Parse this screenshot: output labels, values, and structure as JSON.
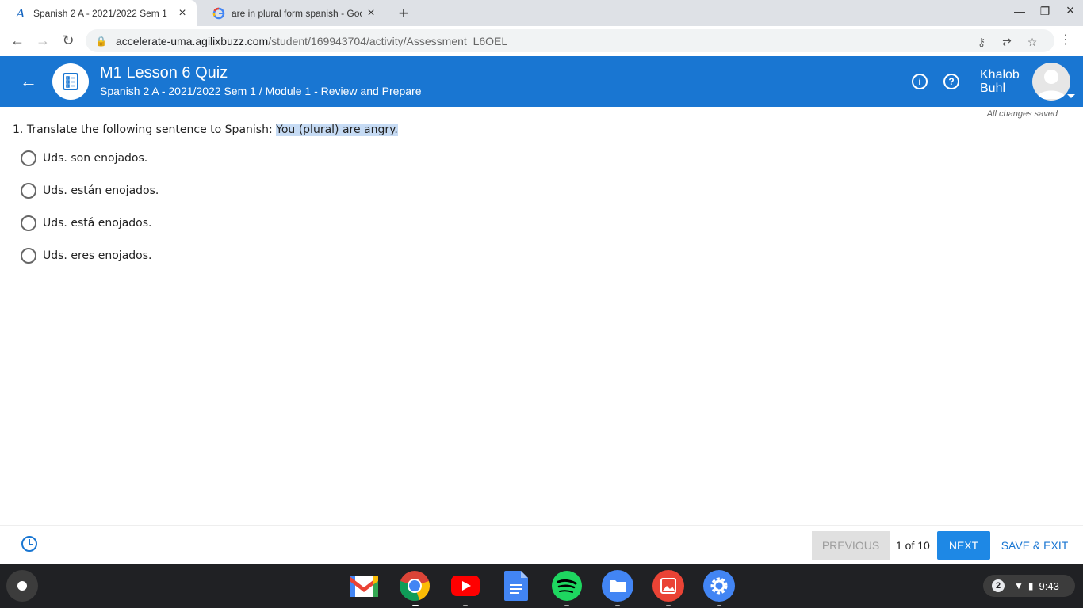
{
  "browser": {
    "tabs": [
      {
        "title": "Spanish 2 A - 2021/2022 Sem 1",
        "favicon": "agilix-logo-icon"
      },
      {
        "title": "are in plural form spanish - Goog",
        "favicon": "google-icon"
      }
    ],
    "url_domain": "accelerate-uma.agilixbuzz.com",
    "url_path": "/student/169943704/activity/Assessment_L6OEL"
  },
  "header": {
    "title": "M1 Lesson 6 Quiz",
    "subtitle": "Spanish 2 A - 2021/2022 Sem 1 / Module 1 - Review and Prepare",
    "user_first": "Khalob",
    "user_last": "Buhl",
    "accent_color": "#1976d2"
  },
  "status": {
    "saved": "All changes saved"
  },
  "question": {
    "number": "1.",
    "prompt": "Translate the following sentence to Spanish:",
    "sentence": "You (plural) are angry.",
    "options": [
      "Uds. son enojados.",
      "Uds. están enojados.",
      "Uds. está enojados.",
      "Uds. eres enojados."
    ]
  },
  "footer": {
    "previous": "PREVIOUS",
    "pager": "1 of 10",
    "next": "NEXT",
    "save_exit": "SAVE & EXIT"
  },
  "shelf": {
    "apps": [
      "gmail-icon",
      "chrome-icon",
      "youtube-icon",
      "docs-icon",
      "spotify-icon",
      "files-icon",
      "gallery-icon",
      "settings-icon"
    ],
    "notifications": "2",
    "time": "9:43"
  }
}
